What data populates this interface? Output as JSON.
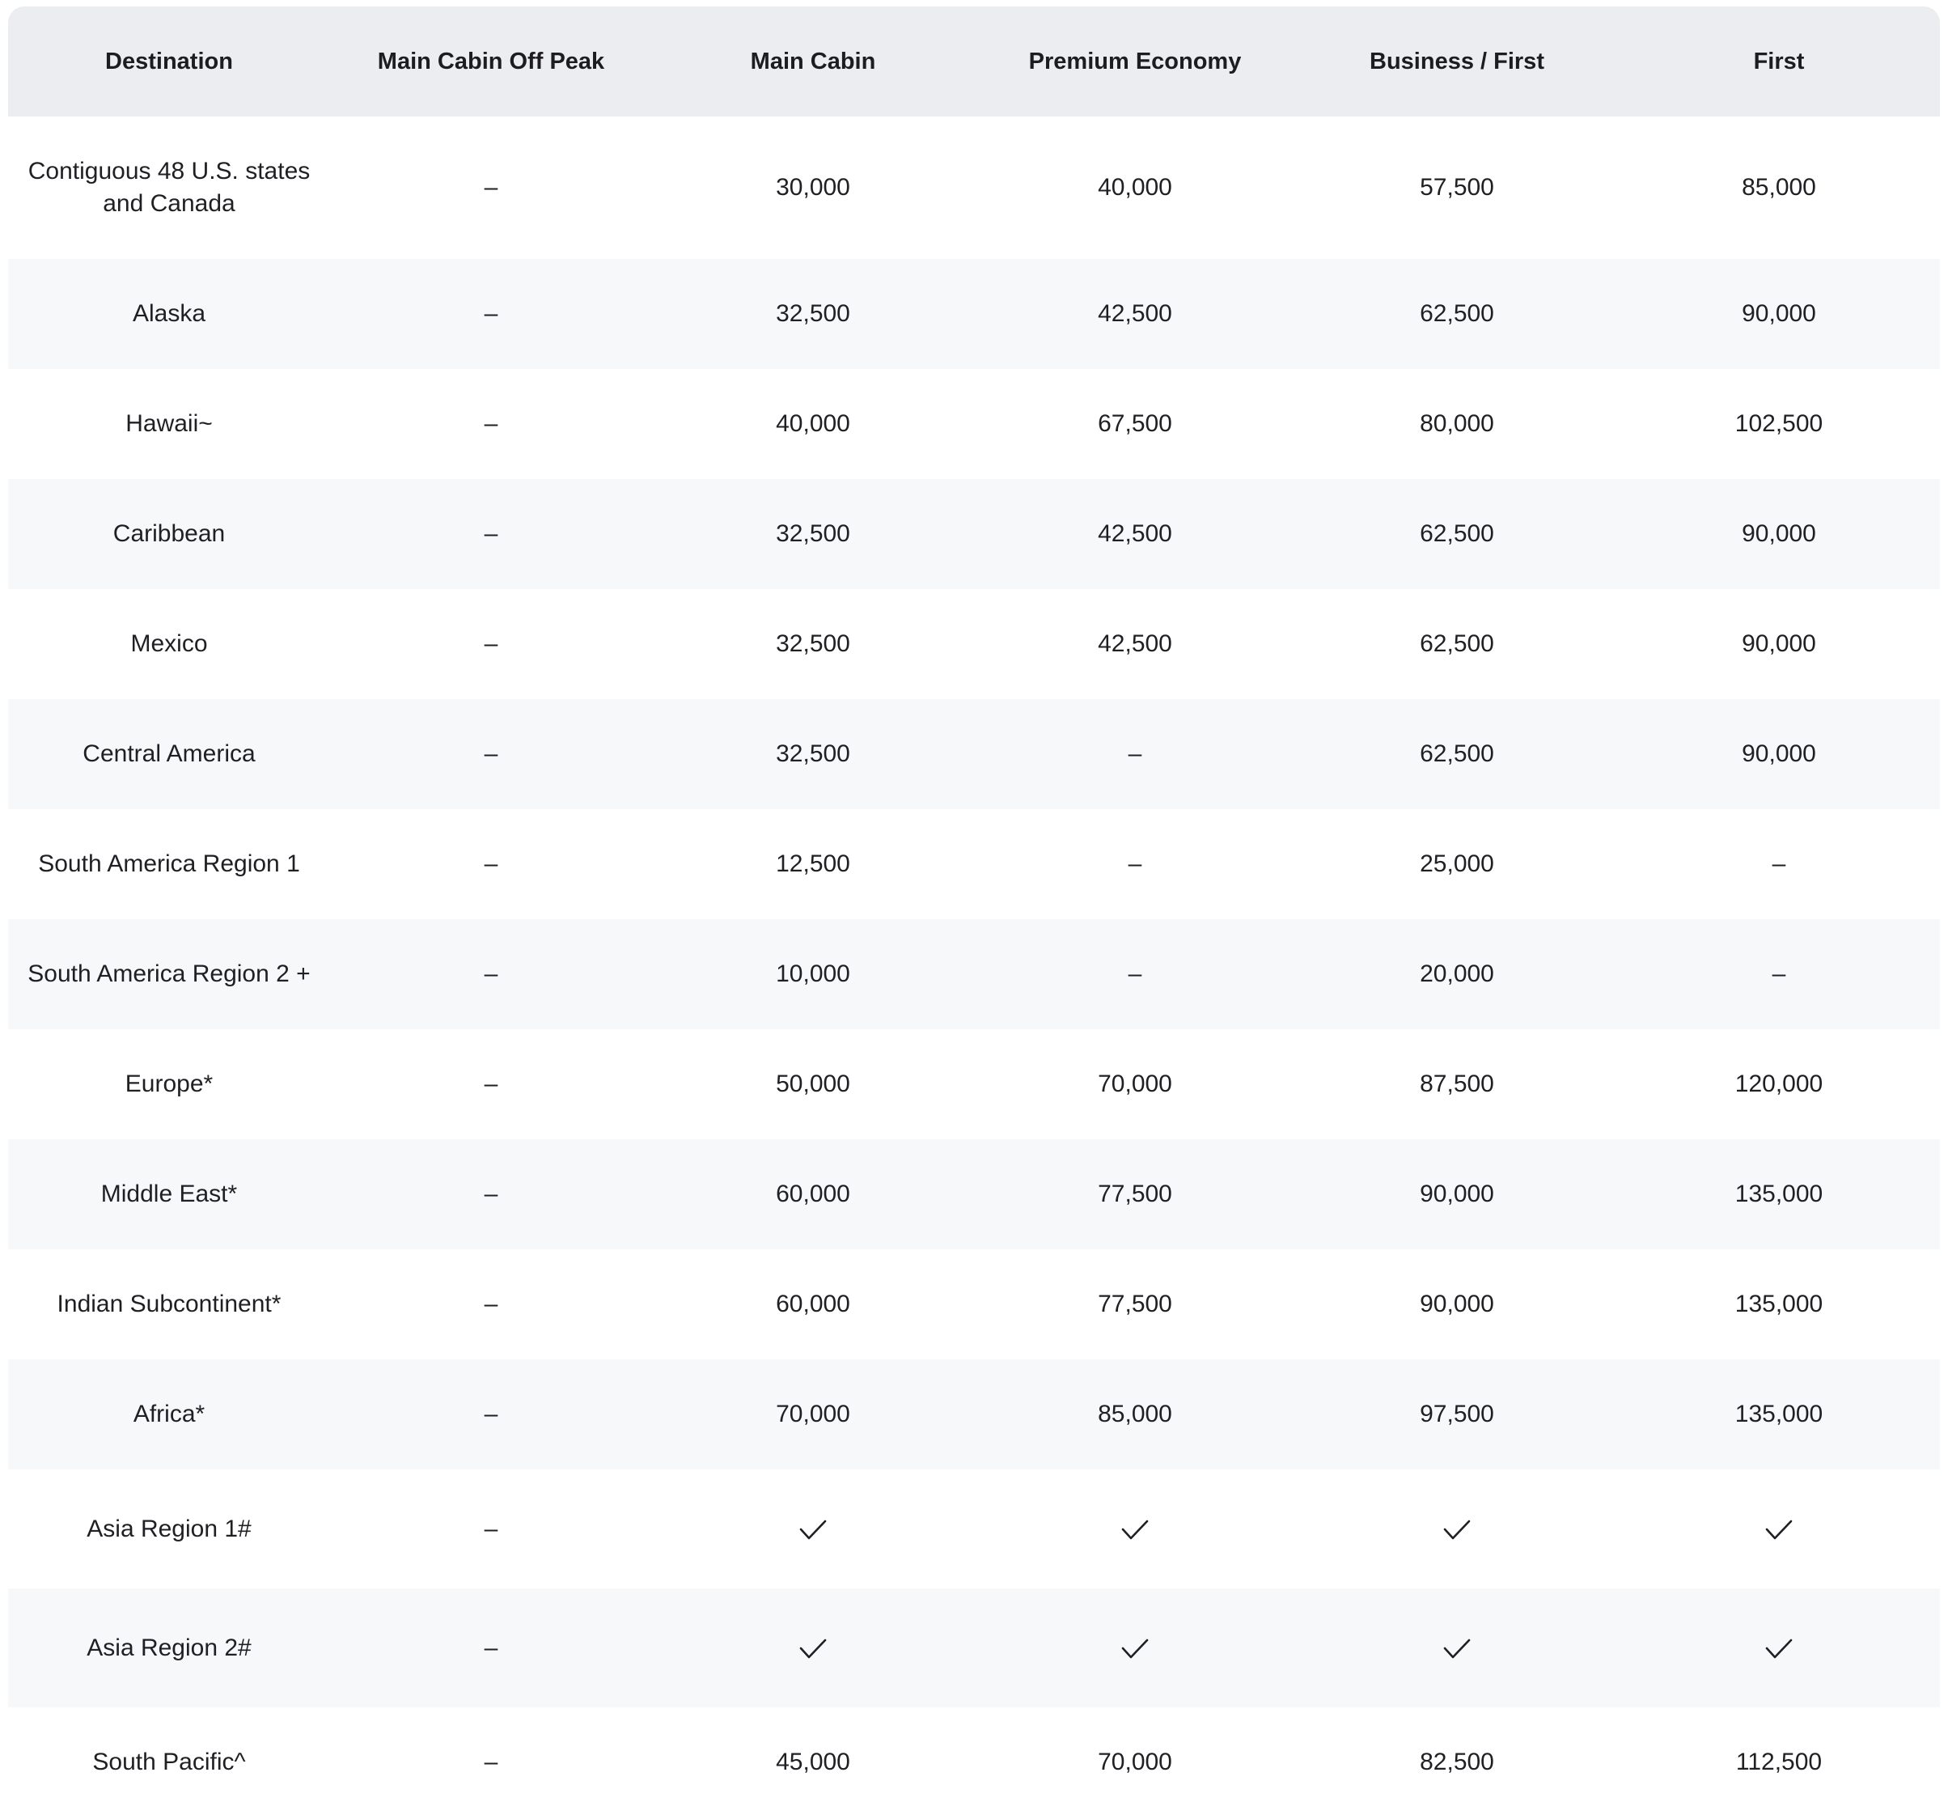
{
  "columns": [
    "Destination",
    "Main Cabin Off Peak",
    "Main Cabin",
    "Premium Economy",
    "Business / First",
    "First"
  ],
  "rows": [
    {
      "destination": "Contiguous 48 U.S. states and Canada",
      "values": [
        "–",
        "30,000",
        "40,000",
        "57,500",
        "85,000"
      ]
    },
    {
      "destination": "Alaska",
      "values": [
        "–",
        "32,500",
        "42,500",
        "62,500",
        "90,000"
      ]
    },
    {
      "destination": "Hawaii~",
      "values": [
        "–",
        "40,000",
        "67,500",
        "80,000",
        "102,500"
      ]
    },
    {
      "destination": "Caribbean",
      "values": [
        "–",
        "32,500",
        "42,500",
        "62,500",
        "90,000"
      ]
    },
    {
      "destination": "Mexico",
      "values": [
        "–",
        "32,500",
        "42,500",
        "62,500",
        "90,000"
      ]
    },
    {
      "destination": "Central America",
      "values": [
        "–",
        "32,500",
        "–",
        "62,500",
        "90,000"
      ]
    },
    {
      "destination": "South America Region 1",
      "values": [
        "–",
        "12,500",
        "–",
        "25,000",
        "–"
      ]
    },
    {
      "destination": "South America Region 2 +",
      "values": [
        "–",
        "10,000",
        "–",
        "20,000",
        "–"
      ]
    },
    {
      "destination": "Europe*",
      "values": [
        "–",
        "50,000",
        "70,000",
        "87,500",
        "120,000"
      ]
    },
    {
      "destination": "Middle East*",
      "values": [
        "–",
        "60,000",
        "77,500",
        "90,000",
        "135,000"
      ]
    },
    {
      "destination": "Indian Subcontinent*",
      "values": [
        "–",
        "60,000",
        "77,500",
        "90,000",
        "135,000"
      ]
    },
    {
      "destination": "Africa*",
      "values": [
        "–",
        "70,000",
        "85,000",
        "97,500",
        "135,000"
      ]
    },
    {
      "destination": "Asia Region 1#",
      "values": [
        "–",
        "check",
        "check",
        "check",
        "check"
      ]
    },
    {
      "destination": "Asia Region 2#",
      "values": [
        "–",
        "check",
        "check",
        "check",
        "check"
      ]
    },
    {
      "destination": "South Pacific^",
      "values": [
        "–",
        "45,000",
        "70,000",
        "82,500",
        "112,500"
      ]
    }
  ],
  "icons": {
    "check": "checkmark-icon"
  },
  "colors": {
    "header_background": "#ecedf0",
    "stripe_background": "#f7f8fa",
    "text": "#1f1f24"
  }
}
